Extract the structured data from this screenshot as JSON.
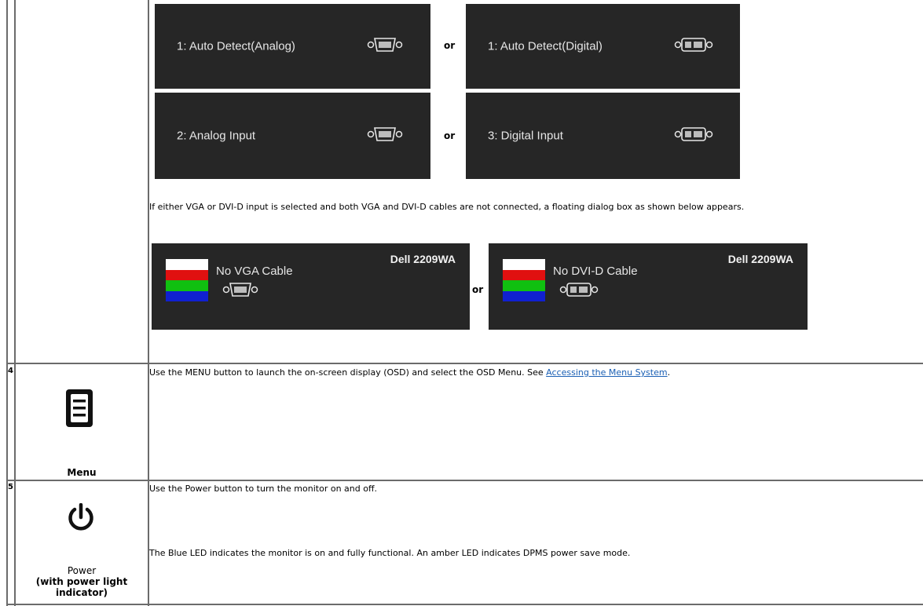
{
  "osd_inputs": {
    "auto_analog": "1: Auto Detect(Analog)",
    "auto_digital": "1: Auto Detect(Digital)",
    "analog_input": "2: Analog Input",
    "digital_input": "3: Digital Input",
    "or_label": "or"
  },
  "notice_text": "If either VGA or DVI-D input is selected and both VGA and DVI-D cables are not connected, a floating dialog box as shown below appears.",
  "cable_dialogs": {
    "model": "Dell 2209WA",
    "no_vga": "No VGA Cable",
    "no_dvi": "No DVI-D Cable",
    "or_label": "or"
  },
  "rows": [
    {
      "number": "4",
      "caption": "Menu",
      "text_before_link": "Use the MENU button to launch the on-screen display (OSD) and select the OSD Menu. See ",
      "link_text": "Accessing the Menu System",
      "text_after_link": ".",
      "icon": "menu-icon"
    },
    {
      "number": "5",
      "caption_line1": "Power",
      "caption_line2": "(with power light",
      "caption_line3": "indicator)",
      "text1": "Use the Power button to turn the monitor on and off.",
      "text2": "The Blue LED indicates the monitor is on and fully functional. An amber LED indicates DPMS power save mode.",
      "icon": "power-icon"
    }
  ],
  "colors": {
    "osd_background": "#262626",
    "link": "#1a5fb4",
    "bar_white": "#ffffff",
    "bar_red": "#e01010",
    "bar_green": "#10c010",
    "bar_blue": "#1020d0"
  }
}
